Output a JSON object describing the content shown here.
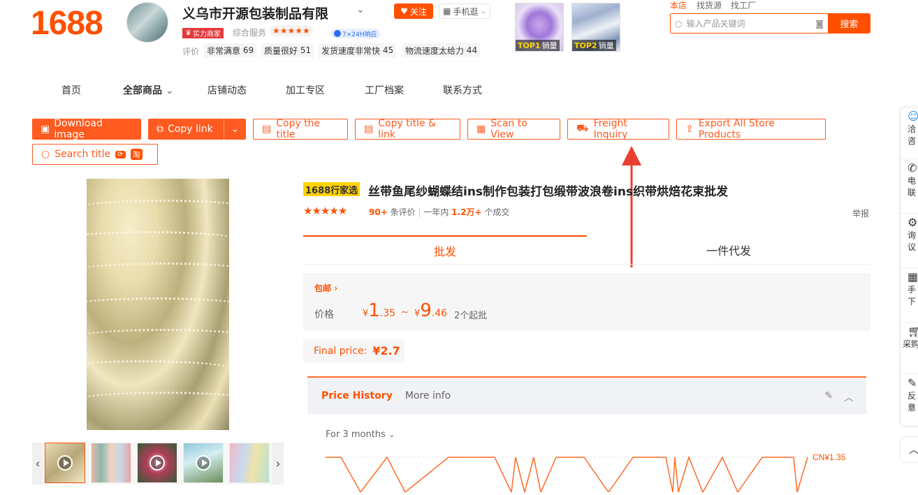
{
  "header": {
    "logo": "1688",
    "shop_name": "义乌市开源包装制品有限",
    "follow_label": "关注",
    "phone_label": "手机逛",
    "strength_badge": "实力商家",
    "composite_label": "综合服务",
    "composite_stars": "★★★★★",
    "response_badge": "7×24H响应",
    "review_label": "评价",
    "review_tags": [
      {
        "label": "非常满意",
        "value": "69"
      },
      {
        "label": "质量很好",
        "value": "51"
      },
      {
        "label": "发货速度非常快",
        "value": "45"
      },
      {
        "label": "物流速度太给力",
        "value": "44"
      }
    ],
    "top_products": [
      {
        "rank": "TOP1",
        "label": "销量"
      },
      {
        "rank": "TOP2",
        "label": "销量"
      }
    ],
    "top_links": [
      "本店",
      "找货源",
      "找工厂"
    ],
    "search_placeholder": "输入产品关键词",
    "search_button": "搜索"
  },
  "nav": {
    "items": [
      "首页",
      "全部商品",
      "店铺动态",
      "加工专区",
      "工厂档案",
      "联系方式"
    ]
  },
  "toolbar": {
    "download_image": "Download image",
    "copy_link": "Copy link",
    "copy_title": "Copy the title",
    "copy_title_link": "Copy title & link",
    "scan_to_view": "Scan to View",
    "freight_inquiry": "Freight Inquiry",
    "export_all": "Export All Store Products",
    "search_title": "Search title",
    "taobao_badge": "淘"
  },
  "product": {
    "badge": "1688行家选",
    "title": "丝带鱼尾纱蝴蝶结ins制作包装打包缎带波浪卷ins织带烘焙花束批发",
    "rating_stars": "★★★★★",
    "review_count": "90+",
    "review_suffix": "条评价",
    "separator": "|",
    "year_prefix": "一年内",
    "sold_count": "1.2万+",
    "sold_suffix": "个成交",
    "report": "举报",
    "tab_wholesale": "批发",
    "tab_dropship": "一件代发",
    "free_shipping": "包邮",
    "price_label": "价格",
    "currency": "¥",
    "price_min_int": "1",
    "price_min_dec": ".35",
    "price_tilde": "~",
    "price_max_int": "9",
    "price_max_dec": ".46",
    "min_order": "2个起批",
    "final_price_label": "Final price:",
    "final_price_value": "¥2.7"
  },
  "price_history": {
    "tab_active": "Price History",
    "tab_more": "More info",
    "period": "For 3 months",
    "current_price_label": "CN¥1.35"
  },
  "sidebar": {
    "items": [
      {
        "l1": "洽",
        "l2": "咨"
      },
      {
        "l1": "电",
        "l2": "联"
      },
      {
        "l1": "询",
        "l2": "议"
      },
      {
        "l1": "手",
        "l2": "下"
      },
      {
        "l1": "采购",
        "l2": ""
      },
      {
        "l1": "反",
        "l2": "意"
      }
    ]
  },
  "colors": {
    "brand_orange": "#ff5000",
    "annotation_red": "#e8402f"
  }
}
